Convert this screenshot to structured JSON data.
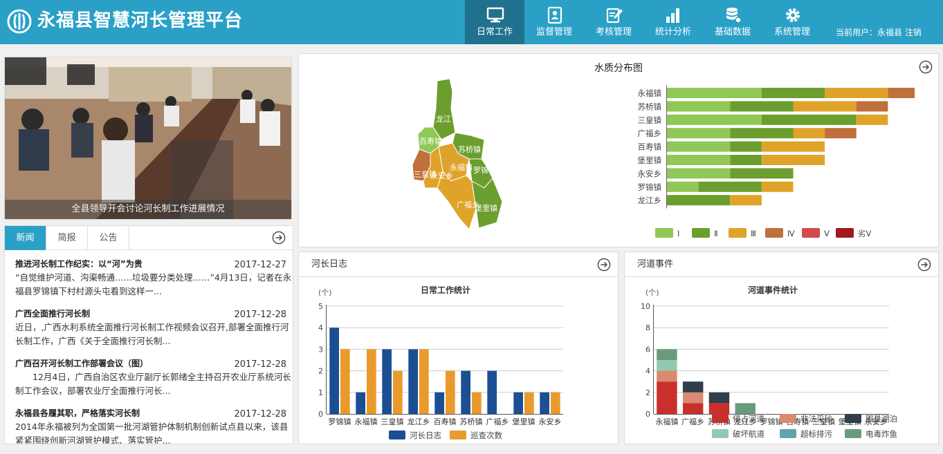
{
  "header": {
    "title": "永福县智慧河长管理平台",
    "nav": [
      {
        "label": "日常工作",
        "icon": "monitor-icon",
        "active": true
      },
      {
        "label": "监督管理",
        "icon": "id-card-icon",
        "active": false
      },
      {
        "label": "考核管理",
        "icon": "edit-clipboard-icon",
        "active": false
      },
      {
        "label": "统计分析",
        "icon": "bar-chart-icon",
        "active": false
      },
      {
        "label": "基础数据",
        "icon": "database-icon",
        "active": false
      },
      {
        "label": "系统管理",
        "icon": "gear-icon",
        "active": false
      }
    ],
    "user_label": "当前用户：永福县",
    "logout_label": "注销",
    "colors": {
      "bar": "#2aa0c7",
      "active": "#20718e"
    }
  },
  "photo": {
    "caption": "全县领导开会讨论河长制工作进展情况"
  },
  "news": {
    "tabs": [
      "新闻",
      "简报",
      "公告"
    ],
    "active_tab": 0,
    "items": [
      {
        "title": "推进河长制工作纪实：以“河”为贵",
        "date": "2017-12-27",
        "summary": "“自觉维护河道、沟渠畅通……垃圾要分类处理……”4月13日，记者在永福县罗锦镇下村村源头屯看到这样一..."
      },
      {
        "title": "广西全面推行河长制",
        "date": "2017-12-28",
        "summary": "近日，,广西水利系统全面推行河长制工作视频会议召开,部署全面推行河长制工作，广西《关于全面推行河长制..."
      },
      {
        "title": "广西召开河长制工作部署会议（图）",
        "date": "2017-12-28",
        "summary": "　　12月4日，广西自治区农业厅副厅长郭绪全主持召开农业厅系统河长制工作会议，部署农业厅全面推行河长..."
      },
      {
        "title": "永福县各履其职，严格落实河长制",
        "date": "2017-12-28",
        "summary": "2014年永福被列为全国第一批河湖管护体制机制创新试点县以来，该县紧紧围绕创新河湖管护模式、落实管护..."
      }
    ]
  },
  "water_quality": {
    "title": "水质分布图",
    "map_labels": [
      "龙江",
      "百寿镇",
      "苏桥镇",
      "永福镇",
      "罗锦镇",
      "三皇镇",
      "广福乡",
      "永安乡",
      "堡里镇"
    ]
  },
  "river_log": {
    "title": "河长日志"
  },
  "river_events": {
    "title": "河道事件"
  },
  "chart_data": [
    {
      "type": "bar",
      "orientation": "horizontal",
      "stacked": true,
      "categories": [
        "永福镇",
        "苏桥镇",
        "三皇镇",
        "广福乡",
        "百寿镇",
        "堡里镇",
        "永安乡",
        "罗锦镇",
        "龙江乡"
      ],
      "series": [
        {
          "name": "Ⅰ",
          "color": "#8fc855",
          "values": [
            3,
            2,
            3,
            2,
            2,
            2,
            2,
            1,
            0
          ]
        },
        {
          "name": "Ⅱ",
          "color": "#6b9e2e",
          "values": [
            2,
            2,
            3,
            2,
            1,
            1,
            2,
            2,
            2
          ]
        },
        {
          "name": "Ⅲ",
          "color": "#e0a32a",
          "values": [
            2,
            2,
            1,
            1,
            2,
            2,
            0,
            1,
            1
          ]
        },
        {
          "name": "Ⅳ",
          "color": "#c0703a",
          "values": [
            1,
            1,
            0,
            1,
            0,
            0,
            0,
            0,
            0
          ]
        },
        {
          "name": "Ⅴ",
          "color": "#d24a4a",
          "values": [
            0,
            0,
            0,
            0,
            0,
            0,
            0,
            0,
            0
          ]
        },
        {
          "name": "劣Ⅴ",
          "color": "#a3171d",
          "values": [
            0,
            0,
            0,
            0,
            0,
            0,
            0,
            0,
            0
          ]
        }
      ],
      "xlim": [
        0,
        8
      ],
      "legend": "bottom"
    },
    {
      "type": "bar",
      "title": "日常工作统计",
      "ylabel": "(个)",
      "categories": [
        "罗锦镇",
        "永福镇",
        "三皇镇",
        "龙江乡",
        "百寿镇",
        "苏桥镇",
        "广福乡",
        "堡里镇",
        "永安乡"
      ],
      "series": [
        {
          "name": "河长日志",
          "color": "#1b4e93",
          "values": [
            4,
            1,
            3,
            3,
            1,
            2,
            2,
            1,
            1
          ]
        },
        {
          "name": "巡查次数",
          "color": "#ea9a2c",
          "values": [
            3,
            3,
            2,
            3,
            2,
            1,
            0,
            1,
            1
          ]
        }
      ],
      "yticks": [
        0,
        1,
        2,
        3,
        4,
        5
      ],
      "ylim": [
        0,
        5
      ],
      "grid": true,
      "legend": "bottom"
    },
    {
      "type": "bar",
      "stacked": true,
      "title": "河道事件统计",
      "ylabel": "(个)",
      "categories": [
        "永福镇",
        "广福乡",
        "苏桥镇",
        "龙江乡",
        "罗锦镇",
        "百寿镇",
        "三皇镇",
        "堡里镇",
        "永安乡"
      ],
      "series": [
        {
          "name": "侵占河道",
          "color": "#c9302c",
          "values": [
            3,
            1,
            1,
            0,
            0,
            0,
            0,
            0,
            0
          ]
        },
        {
          "name": "非法采砂",
          "color": "#d98a6f",
          "values": [
            1,
            1,
            0,
            0,
            0,
            0,
            0,
            0,
            0
          ]
        },
        {
          "name": "围垦湖泊",
          "color": "#2f3e4a",
          "values": [
            0,
            1,
            1,
            0,
            0,
            0,
            0,
            0,
            0
          ]
        },
        {
          "name": "破坏航道",
          "color": "#93c9b0",
          "values": [
            1,
            0,
            0,
            0,
            0,
            0,
            0,
            0,
            0
          ]
        },
        {
          "name": "超标排污",
          "color": "#62a3a9",
          "values": [
            0,
            0,
            0,
            0,
            0,
            0,
            0,
            0,
            0
          ]
        },
        {
          "name": "电毒炸鱼",
          "color": "#6a9a7c",
          "values": [
            1,
            0,
            0,
            1,
            0,
            0,
            0,
            0,
            0
          ]
        }
      ],
      "yticks": [
        0,
        2,
        4,
        6,
        8,
        10
      ],
      "ylim": [
        0,
        10
      ],
      "grid": true,
      "legend": "bottom"
    }
  ]
}
